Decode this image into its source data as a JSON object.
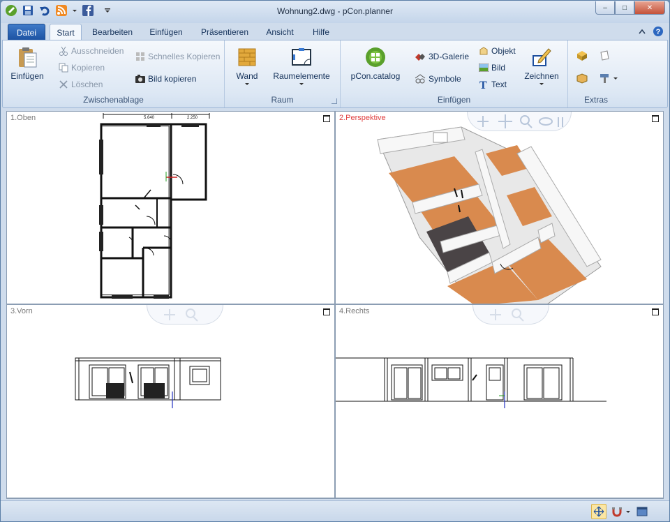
{
  "window": {
    "title": "Wohnung2.dwg - pCon.planner",
    "controls": {
      "minimize": "–",
      "maximize": "□",
      "close": "✕"
    }
  },
  "tabs": {
    "file": "Datei",
    "items": [
      "Start",
      "Bearbeiten",
      "Einfügen",
      "Präsentieren",
      "Ansicht",
      "Hilfe"
    ]
  },
  "ribbon": {
    "clipboard": {
      "label": "Zwischenablage",
      "paste": "Einfügen",
      "cut": "Ausschneiden",
      "copy": "Kopieren",
      "delete": "Löschen",
      "quick_copy": "Schnelles Kopieren",
      "copy_image": "Bild kopieren"
    },
    "room": {
      "label": "Raum",
      "wall": "Wand",
      "room_elements": "Raumelemente"
    },
    "insert": {
      "label": "Einfügen",
      "catalog": "pCon.catalog",
      "gallery": "3D-Galerie",
      "symbols": "Symbole",
      "object": "Objekt",
      "image": "Bild",
      "text": "Text",
      "draw": "Zeichnen"
    },
    "extras": {
      "label": "Extras"
    }
  },
  "viewports": {
    "top": "1.Oben",
    "perspective": "2.Perspektive",
    "front": "3.Vorn",
    "right": "4.Rechts"
  },
  "dimensions": {
    "d1": "5.640",
    "d2": "2.250"
  },
  "colors": {
    "floor": "#d98a4e",
    "accent": "#e04040",
    "tile": "#4a4446"
  }
}
